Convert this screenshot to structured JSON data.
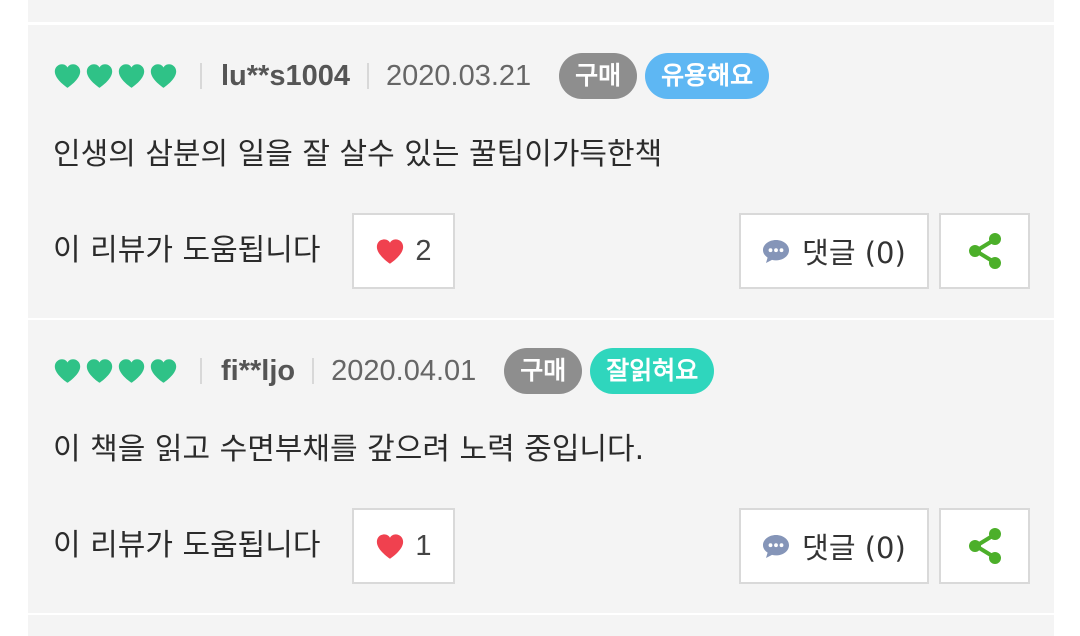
{
  "colors": {
    "heart_rating": "#2fc287",
    "like_heart": "#f0414f",
    "badge_purchase": "#8e8e8e",
    "badge_useful": "#5eb7f3",
    "badge_good_read": "#2fd6bd",
    "share_icon": "#4caf2a",
    "comment_icon": "#8595b8"
  },
  "reviews": [
    {
      "rating_hearts": 4,
      "username": "lu**s1004",
      "date": "2020.03.21",
      "purchase_badge": "구매",
      "tag_badge": "유용해요",
      "content": "인생의 삼분의 일을 잘 살수 있는 꿀팁이가득한책",
      "helpful_label": "이 리뷰가 도움됩니다",
      "likes": "2",
      "comment_label": "댓글 (0)",
      "icons": {
        "like": "heart-icon",
        "comment": "speech-bubble-icon",
        "share": "share-icon"
      }
    },
    {
      "rating_hearts": 4,
      "username": "fi**ljo",
      "date": "2020.04.01",
      "purchase_badge": "구매",
      "tag_badge": "잘읽혀요",
      "content": "이 책을 읽고 수면부채를 갚으려 노력 중입니다.",
      "helpful_label": "이 리뷰가 도움됩니다",
      "likes": "1",
      "comment_label": "댓글 (0)",
      "icons": {
        "like": "heart-icon",
        "comment": "speech-bubble-icon",
        "share": "share-icon"
      }
    }
  ]
}
